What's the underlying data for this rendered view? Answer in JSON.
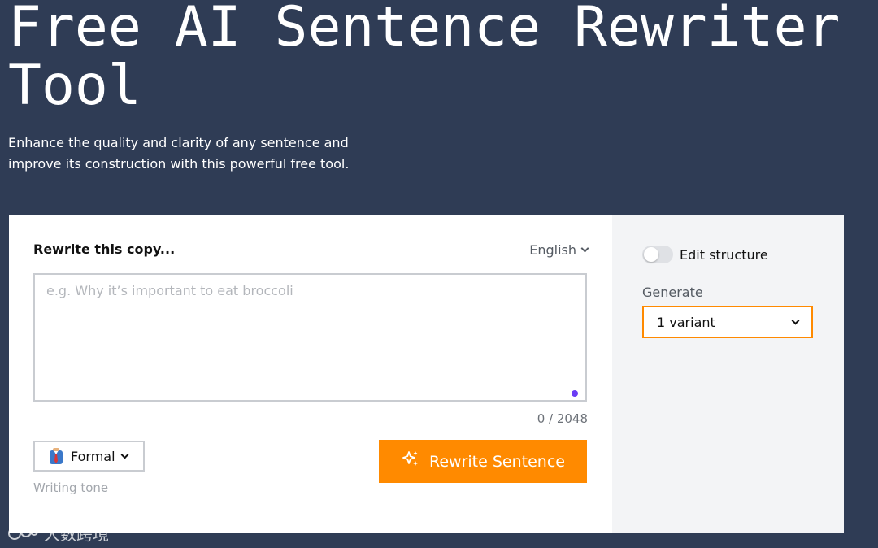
{
  "hero": {
    "title": "Free AI Sentence Rewriter Tool",
    "subtitle": "Enhance the quality and clarity of any sentence and improve its construction with this powerful free tool."
  },
  "editor": {
    "label": "Rewrite this copy...",
    "language": "English",
    "placeholder": "e.g. Why it’s important to eat broccoli",
    "char_count": "0 / 2048",
    "tone_value": "Formal",
    "tone_caption": "Writing tone",
    "tone_icon": "necktie-suit-icon",
    "submit_label": "Rewrite Sentence",
    "submit_icon": "sparkles-icon"
  },
  "options": {
    "edit_structure_label": "Edit structure",
    "edit_structure_on": false,
    "generate_label": "Generate",
    "variant_value": "1 variant"
  },
  "watermark": {
    "text": "大数跨境"
  },
  "colors": {
    "background": "#2f3c55",
    "accent": "#ff8a00",
    "panel": "#f3f4f6",
    "grammar_dot": "#6b3cf5"
  }
}
